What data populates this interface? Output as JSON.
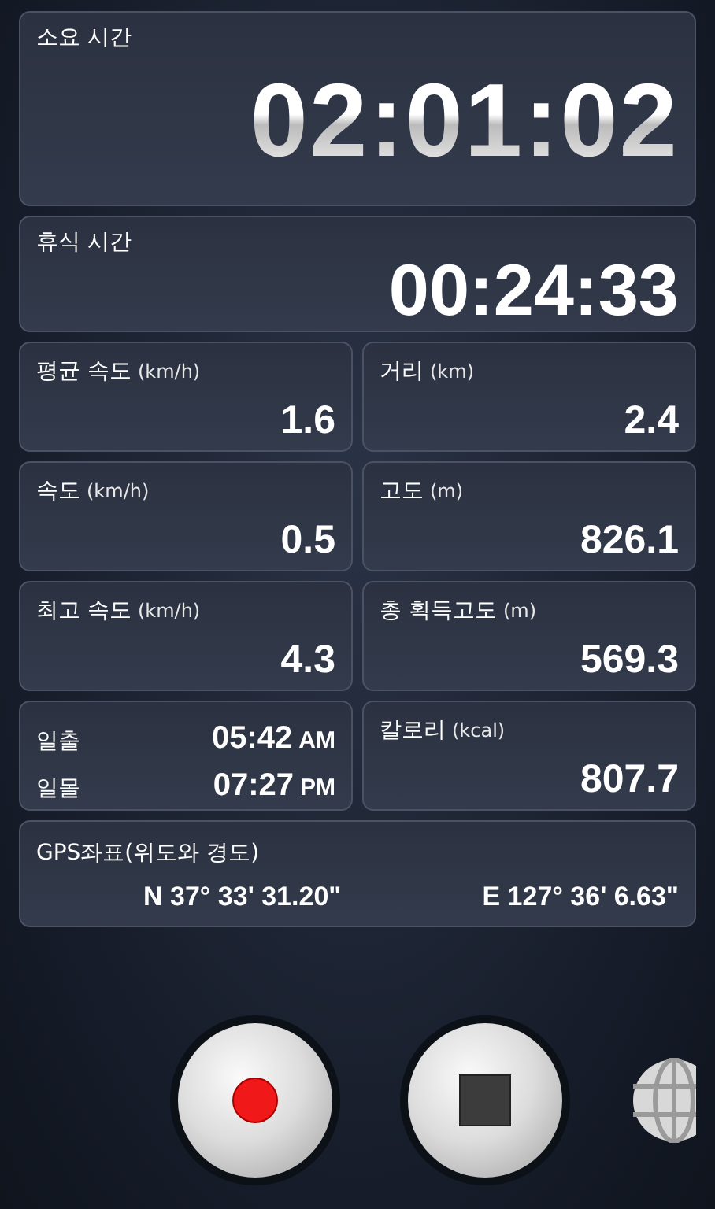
{
  "elapsed": {
    "label": "소요 시간",
    "value": "02:01:02"
  },
  "rest": {
    "label": "휴식 시간",
    "value": "00:24:33"
  },
  "stats": [
    {
      "label": "평균 속도",
      "unit": "(km/h)",
      "value": "1.6"
    },
    {
      "label": "거리",
      "unit": "(km)",
      "value": "2.4"
    },
    {
      "label": "속도",
      "unit": "(km/h)",
      "value": "0.5"
    },
    {
      "label": "고도",
      "unit": "(m)",
      "value": "826.1"
    },
    {
      "label": "최고 속도",
      "unit": "(km/h)",
      "value": "4.3"
    },
    {
      "label": "총 획득고도",
      "unit": "(m)",
      "value": "569.3"
    }
  ],
  "sun": [
    {
      "label": "일출",
      "time": "05:42",
      "ampm": "AM"
    },
    {
      "label": "일몰",
      "time": "07:27",
      "ampm": "PM"
    }
  ],
  "calories": {
    "label": "칼로리",
    "unit": "(kcal)",
    "value": "807.7"
  },
  "gps": {
    "label": "GPS좌표(위도와 경도)",
    "lat": "N 37° 33' 31.20\"",
    "lon": "E 127° 36' 6.63\""
  },
  "controls": [
    {
      "kind": "record"
    },
    {
      "kind": "stop"
    },
    {
      "kind": "globe"
    }
  ]
}
